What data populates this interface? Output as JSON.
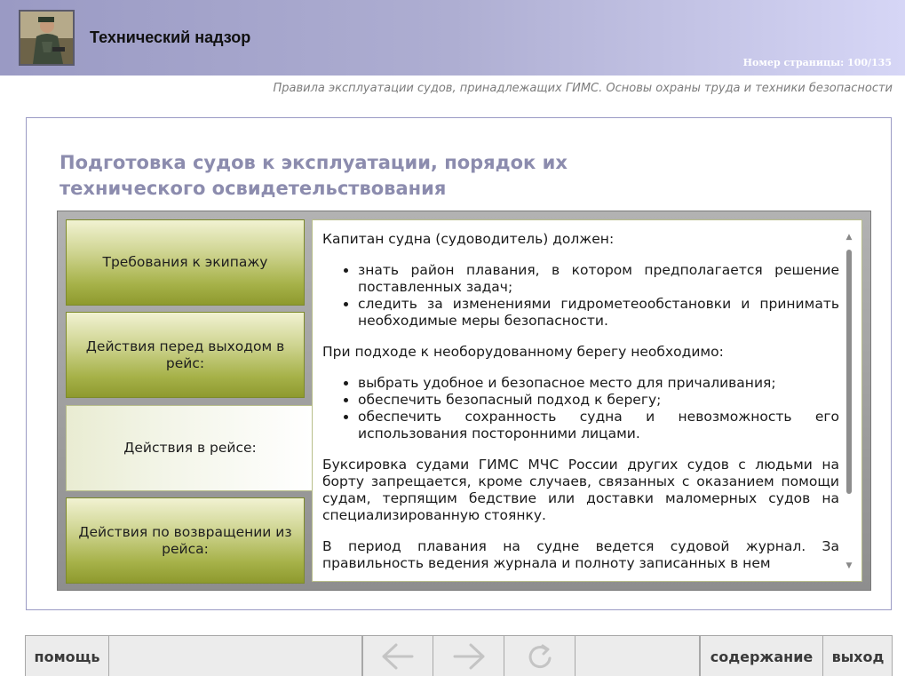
{
  "header": {
    "app_title": "Технический надзор",
    "page_number": "Номер страницы: 100/135",
    "subtitle": "Правила эксплуатации судов, принадлежащих ГИМС. Основы охраны труда и техники безопасности"
  },
  "main": {
    "section_title": "Подготовка судов к эксплуатации, порядок их технического освидетельствования",
    "tabs": [
      {
        "label": "Требования к экипажу",
        "active": false
      },
      {
        "label": "Действия перед выходом в рейс:",
        "active": false
      },
      {
        "label": "Действия в рейсе:",
        "active": true
      },
      {
        "label": "Действия по возвращении из рейса:",
        "active": false
      }
    ],
    "content": {
      "p1": "Капитан судна (судоводитель) должен:",
      "list1": [
        "знать район плавания, в котором предполагается решение поставленных задач;",
        "следить за изменениями гидрометеообстановки и принимать необходимые меры безопасности."
      ],
      "p2": "При подходе к необорудованному берегу необходимо:",
      "list2": [
        "выбрать удобное и безопасное место для причаливания;",
        "обеспечить безопасный подход к берегу;",
        "обеспечить сохранность судна и невозможность его использования посторонними лицами."
      ],
      "p3": "Буксировка судами ГИМС МЧС России других судов с людьми на борту запрещается, кроме случаев, связанных с оказанием помощи судам, терпящим бедствие или доставки маломерных судов на специализированную стоянку.",
      "p4": "В период плавания на судне ведется судовой журнал. За правильность ведения журнала и полноту записанных в нем"
    }
  },
  "footer": {
    "help_label": "помощь",
    "contents_label": "содержание",
    "exit_label": "выход",
    "back_icon": "arrow-left-icon",
    "forward_icon": "arrow-right-icon",
    "reload_icon": "reload-icon"
  },
  "colors": {
    "header_gradient_start": "#9a9ac4",
    "header_gradient_end": "#d6d6f6",
    "title_color": "#8c8cae",
    "tab_green": "#a7b24a"
  }
}
